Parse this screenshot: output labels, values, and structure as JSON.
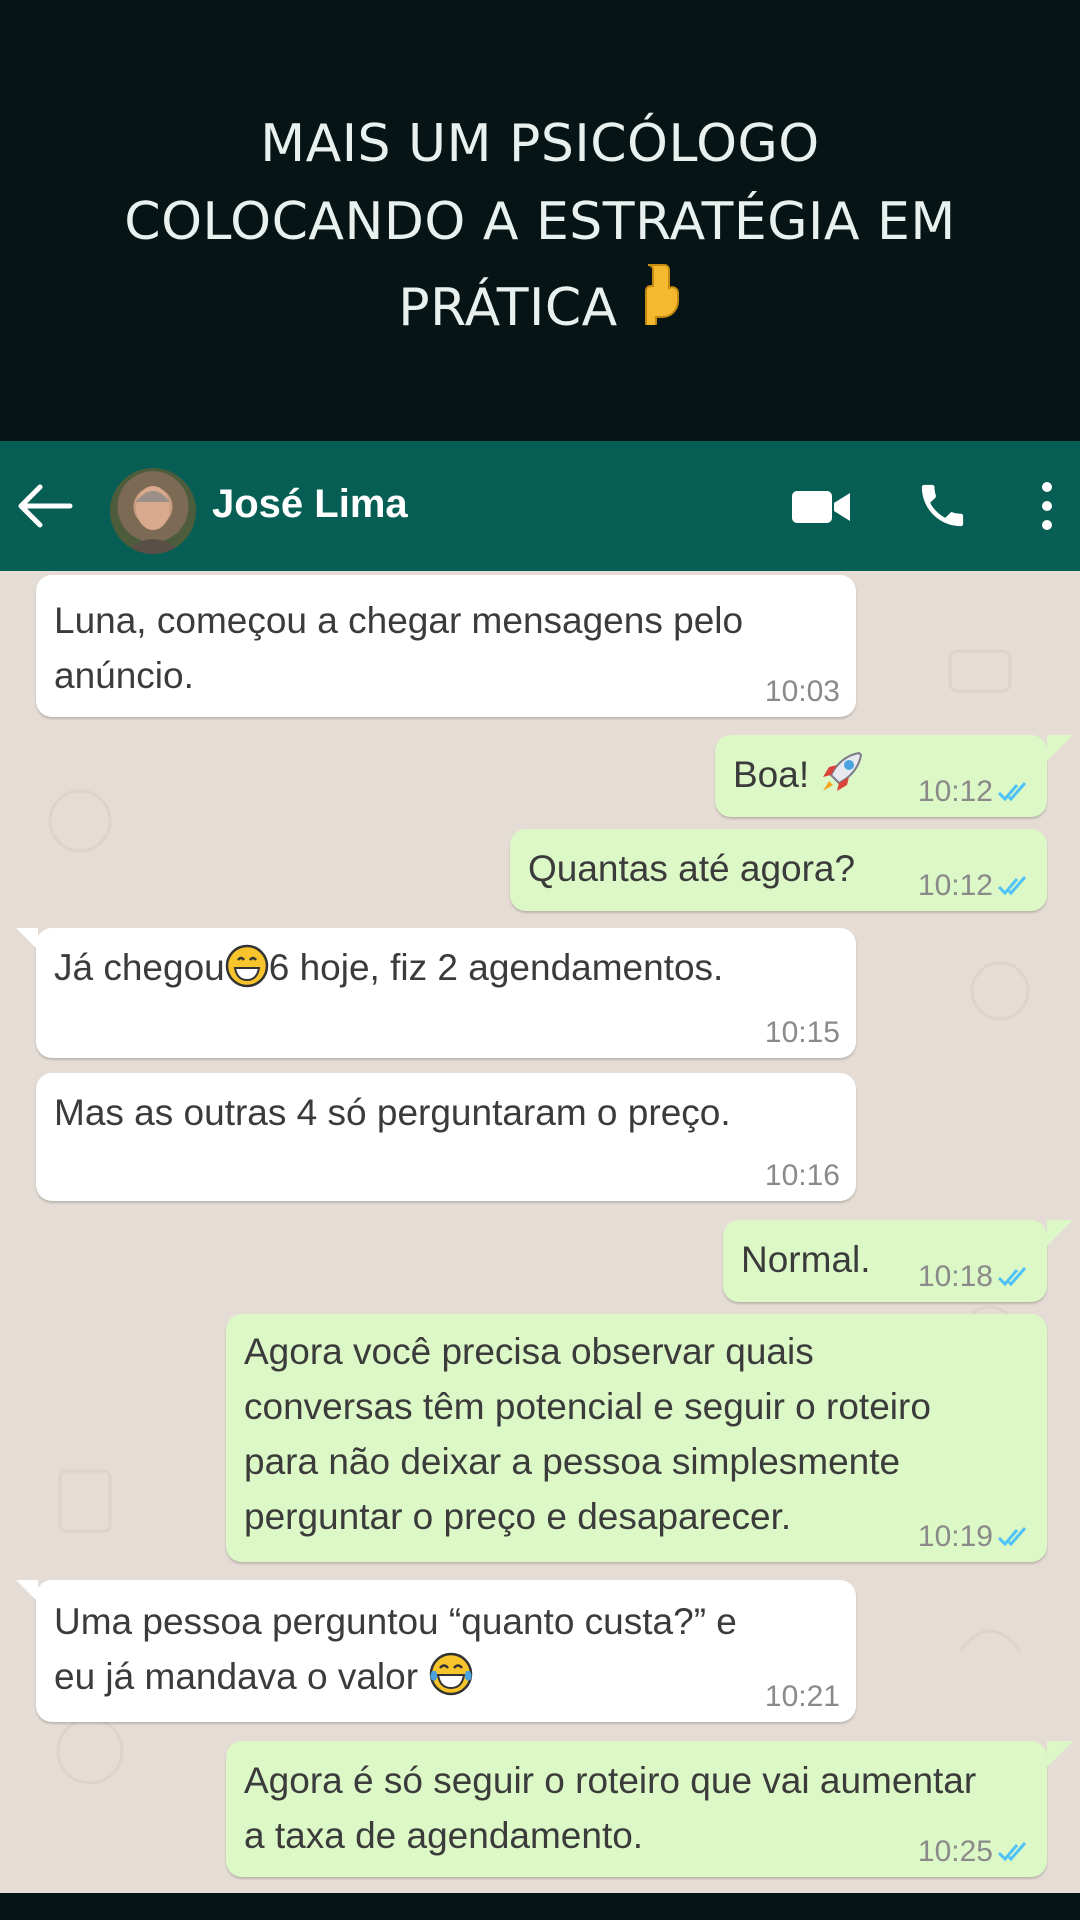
{
  "banner": {
    "line1": "MAIS UM PSICÓLOGO",
    "line2": "COLOCANDO A ESTRATÉGIA EM",
    "line3": "PRÁTICA",
    "emoji": "👇"
  },
  "header": {
    "contact_name": "José Lima",
    "icons": [
      "back-arrow-icon",
      "video-call-icon",
      "phone-icon",
      "more-vert-icon"
    ]
  },
  "colors": {
    "header_bg": "#075e54",
    "incoming_bubble": "#ffffff",
    "outgoing_bubble": "#dcf8c6",
    "chat_bg": "#e5ddd5",
    "banner_bg": "#061416",
    "read_ticks": "#4fc3f7"
  },
  "messages": [
    {
      "dir": "in",
      "text_a": "Luna, começou a chegar mensagens pelo",
      "text_b": "anúncio.",
      "time": "10:03"
    },
    {
      "dir": "out",
      "text": "Boa!",
      "emoji": "rocket",
      "time": "10:12"
    },
    {
      "dir": "out",
      "text": "Quantas até agora?",
      "time": "10:12"
    },
    {
      "dir": "in",
      "text_a": "Já chegou",
      "emoji": "grinning",
      "text_b": "6 hoje, fiz 2 agendamentos.",
      "time": "10:15"
    },
    {
      "dir": "in",
      "text": "Mas as outras 4 só perguntaram o preço.",
      "time": "10:16"
    },
    {
      "dir": "out",
      "text": "Normal.",
      "time": "10:18"
    },
    {
      "dir": "out",
      "lines": [
        "Agora você precisa observar quais",
        "conversas têm potencial e seguir o roteiro",
        "para não deixar a pessoa simplesmente",
        "perguntar o preço e desaparecer."
      ],
      "time": "10:19"
    },
    {
      "dir": "in",
      "text_a": "Uma pessoa perguntou “quanto custa?” e",
      "text_b": "eu já mandava o valor",
      "emoji": "joy",
      "time": "10:21"
    },
    {
      "dir": "out",
      "lines": [
        "Agora é só seguir o roteiro que vai aumentar",
        "a taxa de agendamento."
      ],
      "time": "10:25"
    }
  ]
}
